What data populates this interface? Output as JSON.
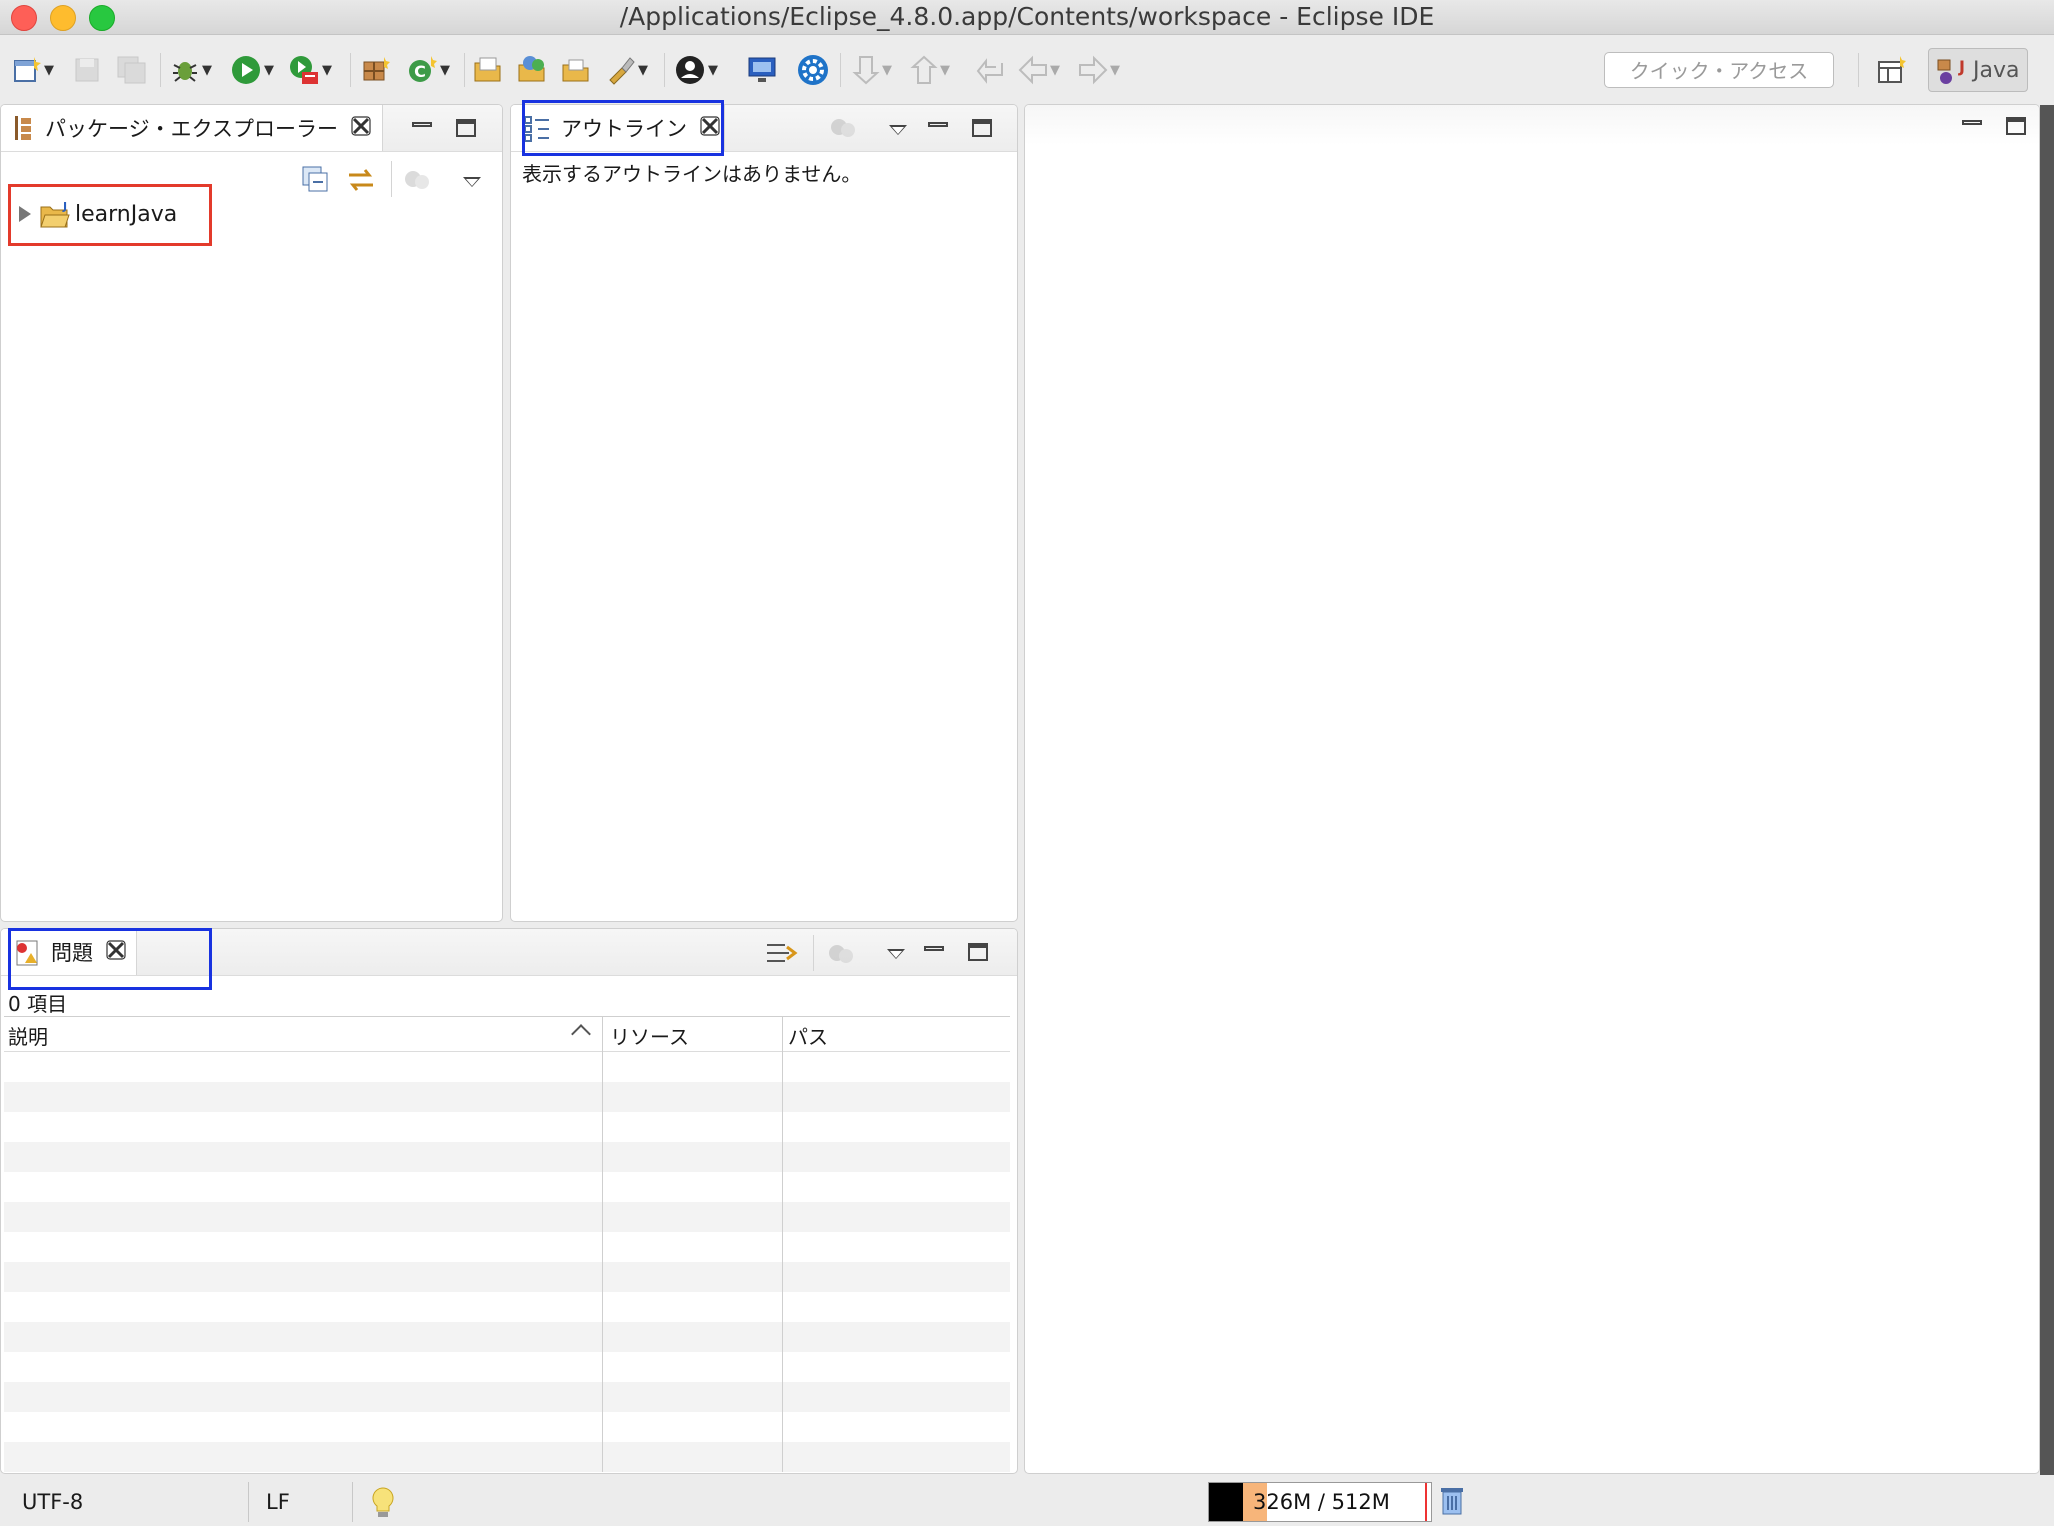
{
  "window": {
    "title": "/Applications/Eclipse_4.8.0.app/Contents/workspace - Eclipse IDE"
  },
  "toolbar": {
    "quick_access_placeholder": "クイック・アクセス",
    "perspective_label": "Java"
  },
  "package_explorer": {
    "tab_label": "パッケージ・エクスプローラー",
    "items": [
      {
        "label": "learnJava",
        "expanded": false
      }
    ]
  },
  "outline": {
    "tab_label": "アウトライン",
    "empty_message": "表示するアウトラインはありません。"
  },
  "problems": {
    "tab_label": "問題",
    "count_text": "0 項目",
    "columns": [
      "説明",
      "リソース",
      "パス"
    ],
    "rows": []
  },
  "status": {
    "encoding": "UTF-8",
    "line_delimiter": "LF",
    "heap_label": "326M / 512M",
    "heap_used_fraction": 0.64
  },
  "colors": {
    "highlight_red": "#e33a2b",
    "highlight_blue": "#1832e0"
  }
}
